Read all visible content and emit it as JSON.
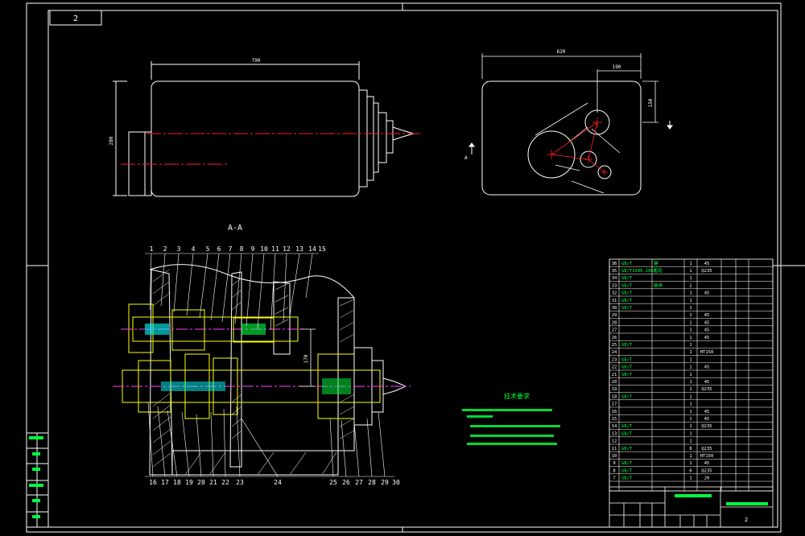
{
  "colors": {
    "background": "#000000",
    "frame": "#ffffff",
    "centerline": "#ff2020",
    "dimension": "#00ffff",
    "text_green": "#00ff40",
    "parts": "#ffff00",
    "hatch": "#a0a0a0"
  },
  "drawing": {
    "corner_tag": "2",
    "section_label": "A-A",
    "dim_length_front": "790",
    "dim_height_front": "280",
    "dim_width_side": "620",
    "dim_offset_side": "190",
    "dim_vertical_side": "150",
    "dim_center": "170",
    "view_arrow_label": "A",
    "tech_notes_title": "技术要求"
  },
  "balloons_top": [
    "1",
    "2",
    "3",
    "4",
    "5",
    "6",
    "7",
    "8",
    "9",
    "10",
    "11",
    "12",
    "13",
    "14",
    "15"
  ],
  "balloons_bottom": [
    "16",
    "17",
    "18",
    "19",
    "20",
    "21",
    "22",
    "23",
    "24",
    "25",
    "26",
    "27",
    "28",
    "29",
    "30"
  ],
  "parts_list": [
    {
      "no": "36",
      "code": "GB/T",
      "name": "键",
      "qty": "1",
      "mat": "45"
    },
    {
      "no": "35",
      "code": "GB/T1096-2003",
      "name": "齿轮",
      "qty": "1",
      "mat": "Q235"
    },
    {
      "no": "34",
      "code": "GB/T",
      "name": "",
      "qty": "1",
      "mat": ""
    },
    {
      "no": "33",
      "code": "GB/T",
      "name": "轴承",
      "qty": "2",
      "mat": ""
    },
    {
      "no": "32",
      "code": "GB/T",
      "name": "",
      "qty": "1",
      "mat": "45"
    },
    {
      "no": "31",
      "code": "GB/T",
      "name": "",
      "qty": "1",
      "mat": ""
    },
    {
      "no": "30",
      "code": "GB/T",
      "name": "",
      "qty": "1",
      "mat": ""
    },
    {
      "no": "29",
      "code": "",
      "name": "",
      "qty": "1",
      "mat": "45"
    },
    {
      "no": "28",
      "code": "",
      "name": "",
      "qty": "1",
      "mat": "45"
    },
    {
      "no": "27",
      "code": "",
      "name": "",
      "qty": "1",
      "mat": "45"
    },
    {
      "no": "26",
      "code": "",
      "name": "",
      "qty": "1",
      "mat": "45"
    },
    {
      "no": "25",
      "code": "GB/T",
      "name": "",
      "qty": "1",
      "mat": ""
    },
    {
      "no": "24",
      "code": "",
      "name": "",
      "qty": "1",
      "mat": "HT150"
    },
    {
      "no": "23",
      "code": "GB/T",
      "name": "",
      "qty": "1",
      "mat": ""
    },
    {
      "no": "22",
      "code": "GB/T",
      "name": "",
      "qty": "1",
      "mat": "45"
    },
    {
      "no": "21",
      "code": "GB/T",
      "name": "",
      "qty": "1",
      "mat": ""
    },
    {
      "no": "20",
      "code": "",
      "name": "",
      "qty": "1",
      "mat": "45"
    },
    {
      "no": "19",
      "code": "",
      "name": "",
      "qty": "1",
      "mat": "Q235"
    },
    {
      "no": "18",
      "code": "GB/T",
      "name": "",
      "qty": "1",
      "mat": ""
    },
    {
      "no": "17",
      "code": "",
      "name": "",
      "qty": "1",
      "mat": ""
    },
    {
      "no": "16",
      "code": "",
      "name": "",
      "qty": "1",
      "mat": "45"
    },
    {
      "no": "15",
      "code": "",
      "name": "",
      "qty": "1",
      "mat": "45"
    },
    {
      "no": "14",
      "code": "GB/T",
      "name": "",
      "qty": "1",
      "mat": "Q235"
    },
    {
      "no": "13",
      "code": "GB/T",
      "name": "",
      "qty": "1",
      "mat": ""
    },
    {
      "no": "12",
      "code": "",
      "name": "",
      "qty": "1",
      "mat": ""
    },
    {
      "no": "11",
      "code": "GB/T",
      "name": "",
      "qty": "6",
      "mat": "Q235"
    },
    {
      "no": "10",
      "code": "",
      "name": "",
      "qty": "1",
      "mat": "HT150"
    },
    {
      "no": "9",
      "code": "GB/T",
      "name": "",
      "qty": "1",
      "mat": "45"
    },
    {
      "no": "8",
      "code": "GB/T",
      "name": "",
      "qty": "6",
      "mat": "Q235"
    },
    {
      "no": "7",
      "code": "GB/T",
      "name": "",
      "qty": "1",
      "mat": "20"
    }
  ],
  "title_block": {
    "title": "",
    "sheet": "2"
  },
  "side_strip": {
    "labels": [
      "",
      "",
      "",
      "",
      ""
    ]
  }
}
